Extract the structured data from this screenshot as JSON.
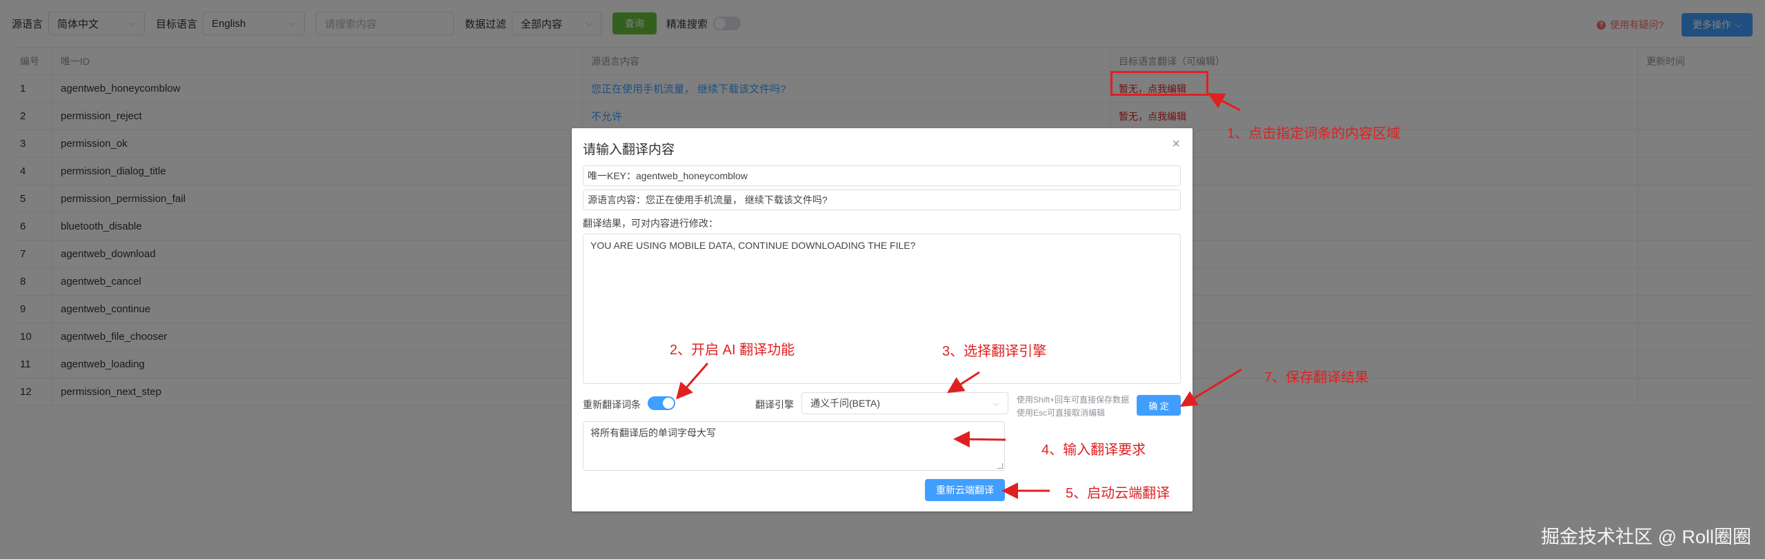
{
  "toolbar": {
    "source_lang_label": "源语言",
    "source_lang_value": "简体中文",
    "target_lang_label": "目标语言",
    "target_lang_value": "English",
    "search_placeholder": "请搜索内容",
    "filter_label": "数据过滤",
    "filter_value": "全部内容",
    "query_label": "查询",
    "exact_search_label": "精准搜索",
    "help_label": "使用有疑问?",
    "more_label": "更多操作"
  },
  "table": {
    "headers": [
      "编号",
      "唯一ID",
      "源语言内容",
      "目标语言翻译（可编辑）",
      "更新时间"
    ],
    "rows": [
      {
        "no": "1",
        "id": "agentweb_honeycomblow",
        "source": "您正在使用手机流量， 继续下载该文件吗?",
        "target": "暂无，点我编辑"
      },
      {
        "no": "2",
        "id": "permission_reject",
        "source": "不允许",
        "target": "暂无，点我编辑"
      },
      {
        "no": "3",
        "id": "permission_ok"
      },
      {
        "no": "4",
        "id": "permission_dialog_title"
      },
      {
        "no": "5",
        "id": "permission_permission_fail"
      },
      {
        "no": "6",
        "id": "bluetooth_disable"
      },
      {
        "no": "7",
        "id": "agentweb_download"
      },
      {
        "no": "8",
        "id": "agentweb_cancel"
      },
      {
        "no": "9",
        "id": "agentweb_continue"
      },
      {
        "no": "10",
        "id": "agentweb_file_chooser"
      },
      {
        "no": "11",
        "id": "agentweb_loading"
      },
      {
        "no": "12",
        "id": "permission_next_step"
      }
    ]
  },
  "dialog": {
    "title": "请输入翻译内容",
    "key_line": "唯一KEY：agentweb_honeycomblow",
    "source_line": "源语言内容：您正在使用手机流量， 继续下载该文件吗?",
    "result_label": "翻译结果，可对内容进行修改：",
    "result_text": "YOU ARE USING MOBILE DATA, CONTINUE DOWNLOADING THE FILE?",
    "retranslate_label": "重新翻译词条",
    "engine_label": "翻译引擎",
    "engine_value": "通义千问(BETA)",
    "hint_line1": "使用Shift+回车可直接保存数据",
    "hint_line2": "使用Esc可直接取消编辑",
    "confirm_label": "确 定",
    "requirement_text": "将所有翻译后的单词字母大写",
    "cloud_translate_label": "重新云端翻译"
  },
  "annotations": {
    "step1": "1、点击指定词条的内容区域",
    "step2": "2、开启 AI 翻译功能",
    "step3": "3、选择翻译引擎",
    "step4": "4、输入翻译要求",
    "step5": "5、启动云端翻译",
    "step7": "7、保存翻译结果"
  },
  "watermark": "掘金技术社区 @ Roll圈圈",
  "colors": {
    "primary": "#409eff",
    "success": "#67c23a",
    "danger": "#e02020"
  }
}
